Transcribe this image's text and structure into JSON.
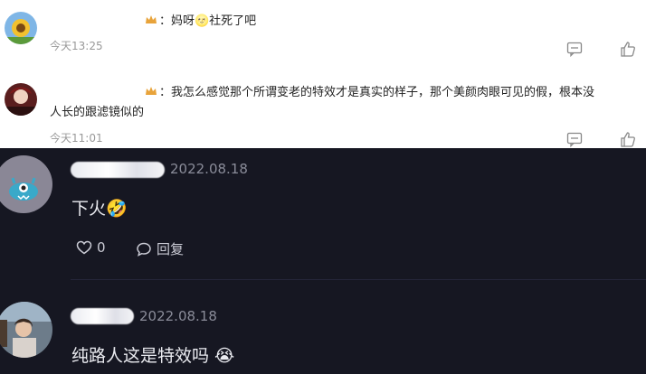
{
  "top_section": {
    "comments": [
      {
        "text": "：妈呀🌝社死了吧",
        "time": "今天13:25"
      },
      {
        "text_line1": "：我怎么感觉那个所谓变老的特效才是真实的样子，那个美颜肉眼可见的假，根本没",
        "text_line2": "人长的跟滤镜似的",
        "time": "今天11:01"
      }
    ]
  },
  "bottom_section": {
    "comments": [
      {
        "date": "2022.08.18",
        "text": "下火🤣",
        "like_count": "0",
        "reply_label": "回复"
      },
      {
        "date": "2022.08.18",
        "text": "纯路人这是特效吗 😭"
      }
    ]
  },
  "colors": {
    "dark_bg": "#161722",
    "light_bg": "#ffffff",
    "muted": "#999999"
  }
}
